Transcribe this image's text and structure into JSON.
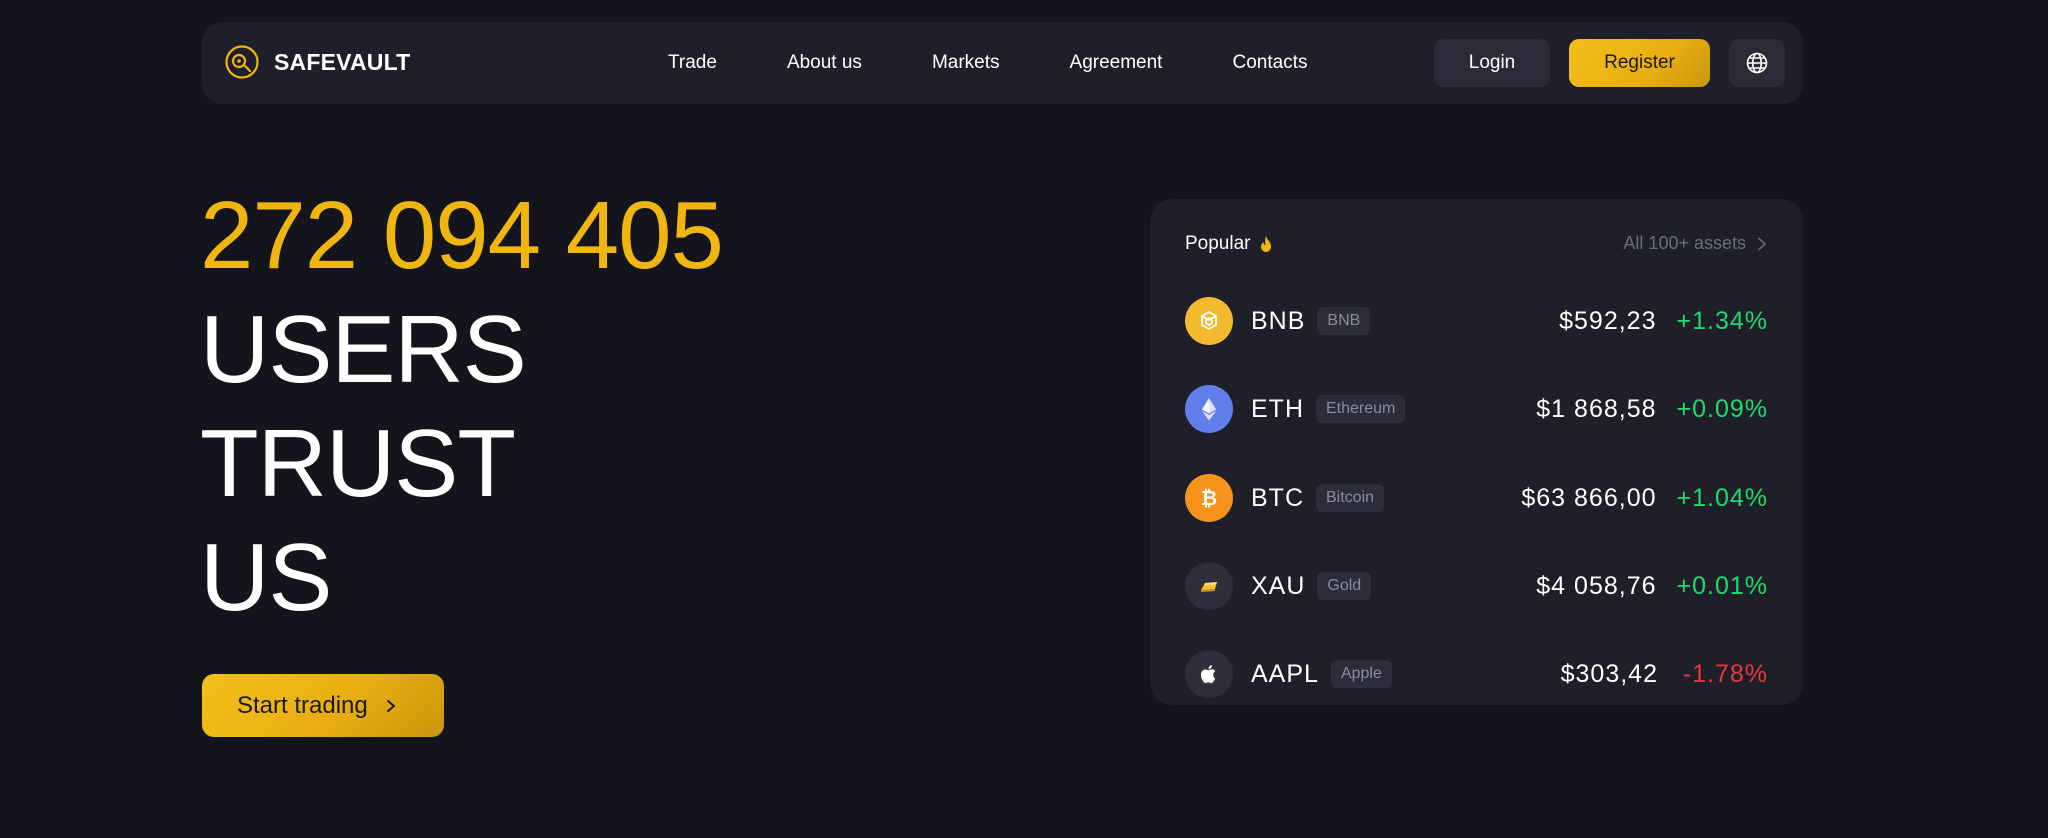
{
  "brand": {
    "name": "SAFEVAULT",
    "logo_icon": "safe-dial-icon",
    "accent": "#f0b50f"
  },
  "nav": {
    "items": [
      {
        "label": "Trade"
      },
      {
        "label": "About us"
      },
      {
        "label": "Markets"
      },
      {
        "label": "Agreement"
      },
      {
        "label": "Contacts"
      }
    ],
    "login_label": "Login",
    "register_label": "Register",
    "language_icon": "globe-icon"
  },
  "hero": {
    "count": "272 094 405",
    "line1": "USERS",
    "line2": "TRUST",
    "line3": "US",
    "cta_label": "Start trading"
  },
  "assets_card": {
    "title": "Popular",
    "title_icon": "fire-icon",
    "all_link": "All 100+ assets",
    "rows": [
      {
        "ticker": "BNB",
        "name": "BNB",
        "price": "$592,23",
        "change": "+1.34%",
        "direction": "up",
        "icon": "bnb-icon",
        "icon_color": "#f3ba2f"
      },
      {
        "ticker": "ETH",
        "name": "Ethereum",
        "price": "$1 868,58",
        "change": "+0.09%",
        "direction": "up",
        "icon": "ethereum-icon",
        "icon_color": "#627eea"
      },
      {
        "ticker": "BTC",
        "name": "Bitcoin",
        "price": "$63 866,00",
        "change": "+1.04%",
        "direction": "up",
        "icon": "bitcoin-icon",
        "icon_color": "#f7931a"
      },
      {
        "ticker": "XAU",
        "name": "Gold",
        "price": "$4 058,76",
        "change": "+0.01%",
        "direction": "up",
        "icon": "gold-bar-icon",
        "icon_color": "#2e2f3b"
      },
      {
        "ticker": "AAPL",
        "name": "Apple",
        "price": "$303,42",
        "change": "-1.78%",
        "direction": "down",
        "icon": "apple-icon",
        "icon_color": "#2e2f3b"
      }
    ]
  },
  "colors": {
    "background": "#13141c",
    "panel": "#1e1f29",
    "up": "#22d96c",
    "down": "#e53a3a"
  }
}
